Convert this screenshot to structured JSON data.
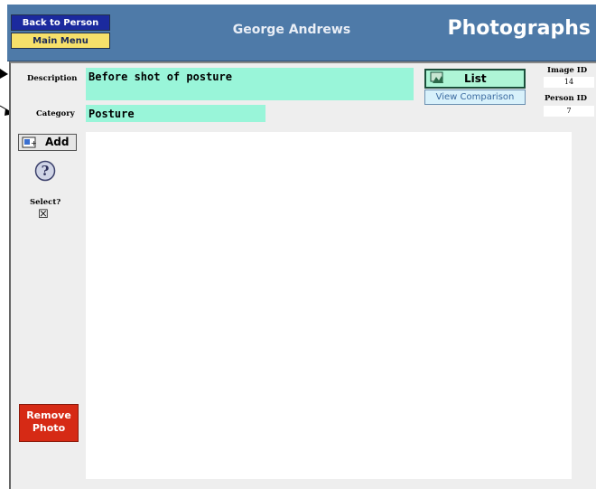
{
  "header": {
    "back_label": "Back to Person",
    "menu_label": "Main Menu",
    "person_name": "George Andrews",
    "title": "Photographs"
  },
  "fields": {
    "description_label": "Description",
    "description_value": "Before shot of posture",
    "category_label": "Category",
    "category_value": "Posture"
  },
  "buttons": {
    "list_label": "List",
    "compare_label": "View Comparison",
    "add_label": "Add",
    "remove_label_line1": "Remove",
    "remove_label_line2": "Photo"
  },
  "ids": {
    "image_id_label": "Image ID",
    "image_id_value": "14",
    "person_id_label": "Person ID",
    "person_id_value": "7"
  },
  "select": {
    "label": "Select?",
    "checked": "☒"
  },
  "icons": {
    "help": "help-icon",
    "list": "list-hand-icon",
    "add": "add-photo-icon"
  },
  "colors": {
    "header": "#4e7aa8",
    "field_bg": "#99f5d9",
    "remove": "#d62a15"
  }
}
